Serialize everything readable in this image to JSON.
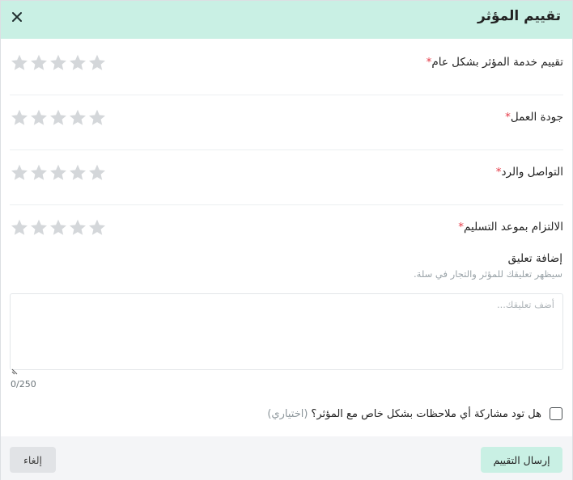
{
  "modal": {
    "title": "تقييم المؤثر",
    "close_icon": "close-icon"
  },
  "ratings": [
    {
      "label": "تقييم خدمة المؤثر بشكل عام",
      "required_mark": "*",
      "value": 0,
      "max": 5
    },
    {
      "label": "جودة العمل",
      "required_mark": "*",
      "value": 0,
      "max": 5
    },
    {
      "label": "التواصل والرد",
      "required_mark": "*",
      "value": 0,
      "max": 5
    },
    {
      "label": "الالتزام بموعد التسليم",
      "required_mark": "*",
      "value": 0,
      "max": 5
    }
  ],
  "comment": {
    "title": "إضافة تعليق",
    "hint": "سيظهر تعليقك للمؤثر والتجار في سلة.",
    "placeholder": "أضف تعليقك...",
    "value": "",
    "counter": "0/250"
  },
  "private_notes": {
    "label": "هل تود مشاركة أي ملاحظات بشكل خاص مع المؤثر؟",
    "optional": "(اختياري)",
    "checked": false
  },
  "footer": {
    "submit_label": "إرسال التقييم",
    "cancel_label": "إلغاء"
  },
  "colors": {
    "header_bg": "#c9f0e4",
    "star_empty": "#d4d7da",
    "required": "#e53946",
    "footer_bg": "#f4f5f7"
  }
}
